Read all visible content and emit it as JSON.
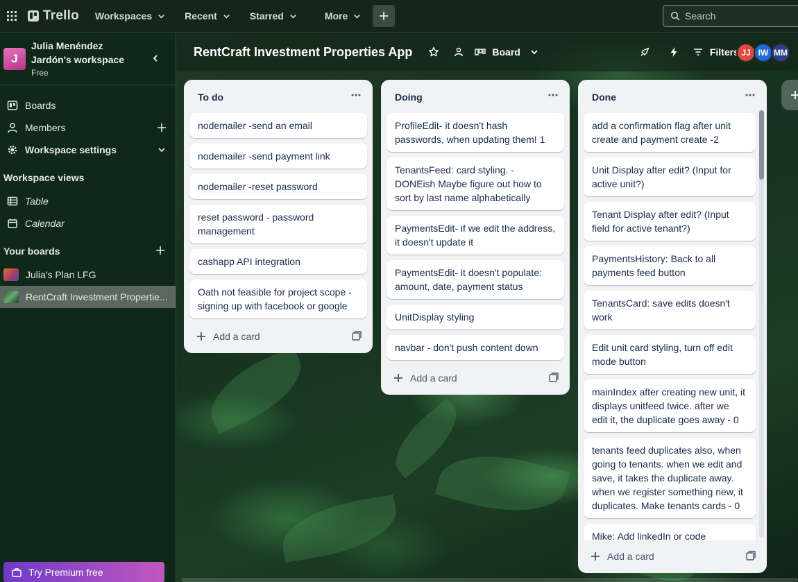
{
  "topbar": {
    "app_name": "Trello",
    "nav": [
      "Workspaces",
      "Recent",
      "Starred",
      "More"
    ],
    "search_placeholder": "Search"
  },
  "sidebar": {
    "workspace_initial": "J",
    "workspace_name": "Julia Menéndez Jardón's workspace",
    "workspace_plan": "Free",
    "items": [
      {
        "label": "Boards",
        "icon": "trello-board-icon"
      },
      {
        "label": "Members",
        "icon": "person-icon"
      },
      {
        "label": "Workspace settings",
        "icon": "gear-icon"
      }
    ],
    "views_heading": "Workspace views",
    "views": [
      {
        "label": "Table",
        "icon": "table-icon"
      },
      {
        "label": "Calendar",
        "icon": "calendar-icon"
      }
    ],
    "boards_heading": "Your boards",
    "boards": [
      {
        "label": "Julia's Plan LFG"
      },
      {
        "label": "RentCraft Investment Propertie..."
      }
    ],
    "premium": "Try Premium free"
  },
  "board": {
    "title": "RentCraft Investment Properties App",
    "view": "Board",
    "filters": "Filters",
    "members": [
      {
        "initials": "JJ",
        "color": "#e2483d"
      },
      {
        "initials": "IW",
        "color": "#1d6bd6"
      },
      {
        "initials": "MM",
        "color": "#2a3e8c"
      }
    ]
  },
  "lists": [
    {
      "title": "To do",
      "cards": [
        "nodemailer -send an email",
        "nodemailer -send payment link",
        "nodemailer -reset password",
        "reset password - password management",
        "cashapp API integration",
        "Oath not feasible for project scope - signing up with facebook or google"
      ],
      "add_label": "Add a card"
    },
    {
      "title": "Doing",
      "cards": [
        "ProfileEdit- it doesn't hash passwords, when updating them! 1",
        "TenantsFeed: card styling. - DONEish Maybe figure out how to sort by last name alphabetically",
        "PaymentsEdit- if we edit the address, it doesn't update it",
        "PaymentsEdit- it doesn't populate: amount, date, payment status",
        "UnitDisplay styling",
        "navbar - don't push content down"
      ],
      "add_label": "Add a card"
    },
    {
      "title": "Done",
      "cards": [
        "add a confirmation flag after unit create and payment create -2",
        "Unit Display after edit? (Input for active unit?)",
        "Tenant Display after edit? (Input field for active tenant?)",
        "PaymentsHistory: Back to all payments feed button",
        "TenantsCard: save edits doesn't work",
        "Edit unit card styling, turn off edit mode button",
        "mainIndex after creating new unit, it displays unitfeed twice. after we edit it, the duplicate goes away - 0",
        "tenants feed duplicates also, when going to tenants. when we edit and save, it takes the duplicate away. when we register something new, it duplicates. Make tenants cards - 0",
        "Mike: Add linkedIn or code"
      ],
      "add_label": "Add a card"
    }
  ]
}
